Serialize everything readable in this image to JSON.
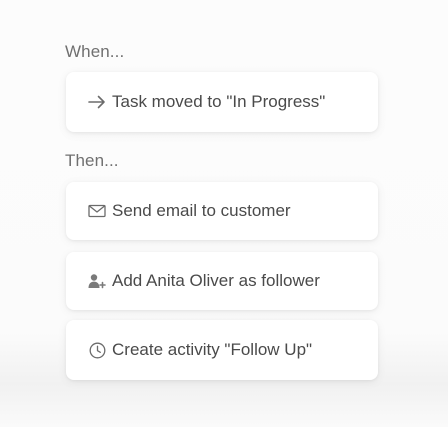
{
  "when": {
    "label": "When...",
    "trigger": {
      "icon": "arrow-right-icon",
      "text": "Task moved to \"In Progress\""
    }
  },
  "then": {
    "label": "Then...",
    "actions": [
      {
        "icon": "envelope-icon",
        "text": "Send email to customer"
      },
      {
        "icon": "add-follower-icon",
        "text": "Add Anita Oliver as follower"
      },
      {
        "icon": "clock-icon",
        "text": "Create activity \"Follow Up\""
      }
    ]
  }
}
